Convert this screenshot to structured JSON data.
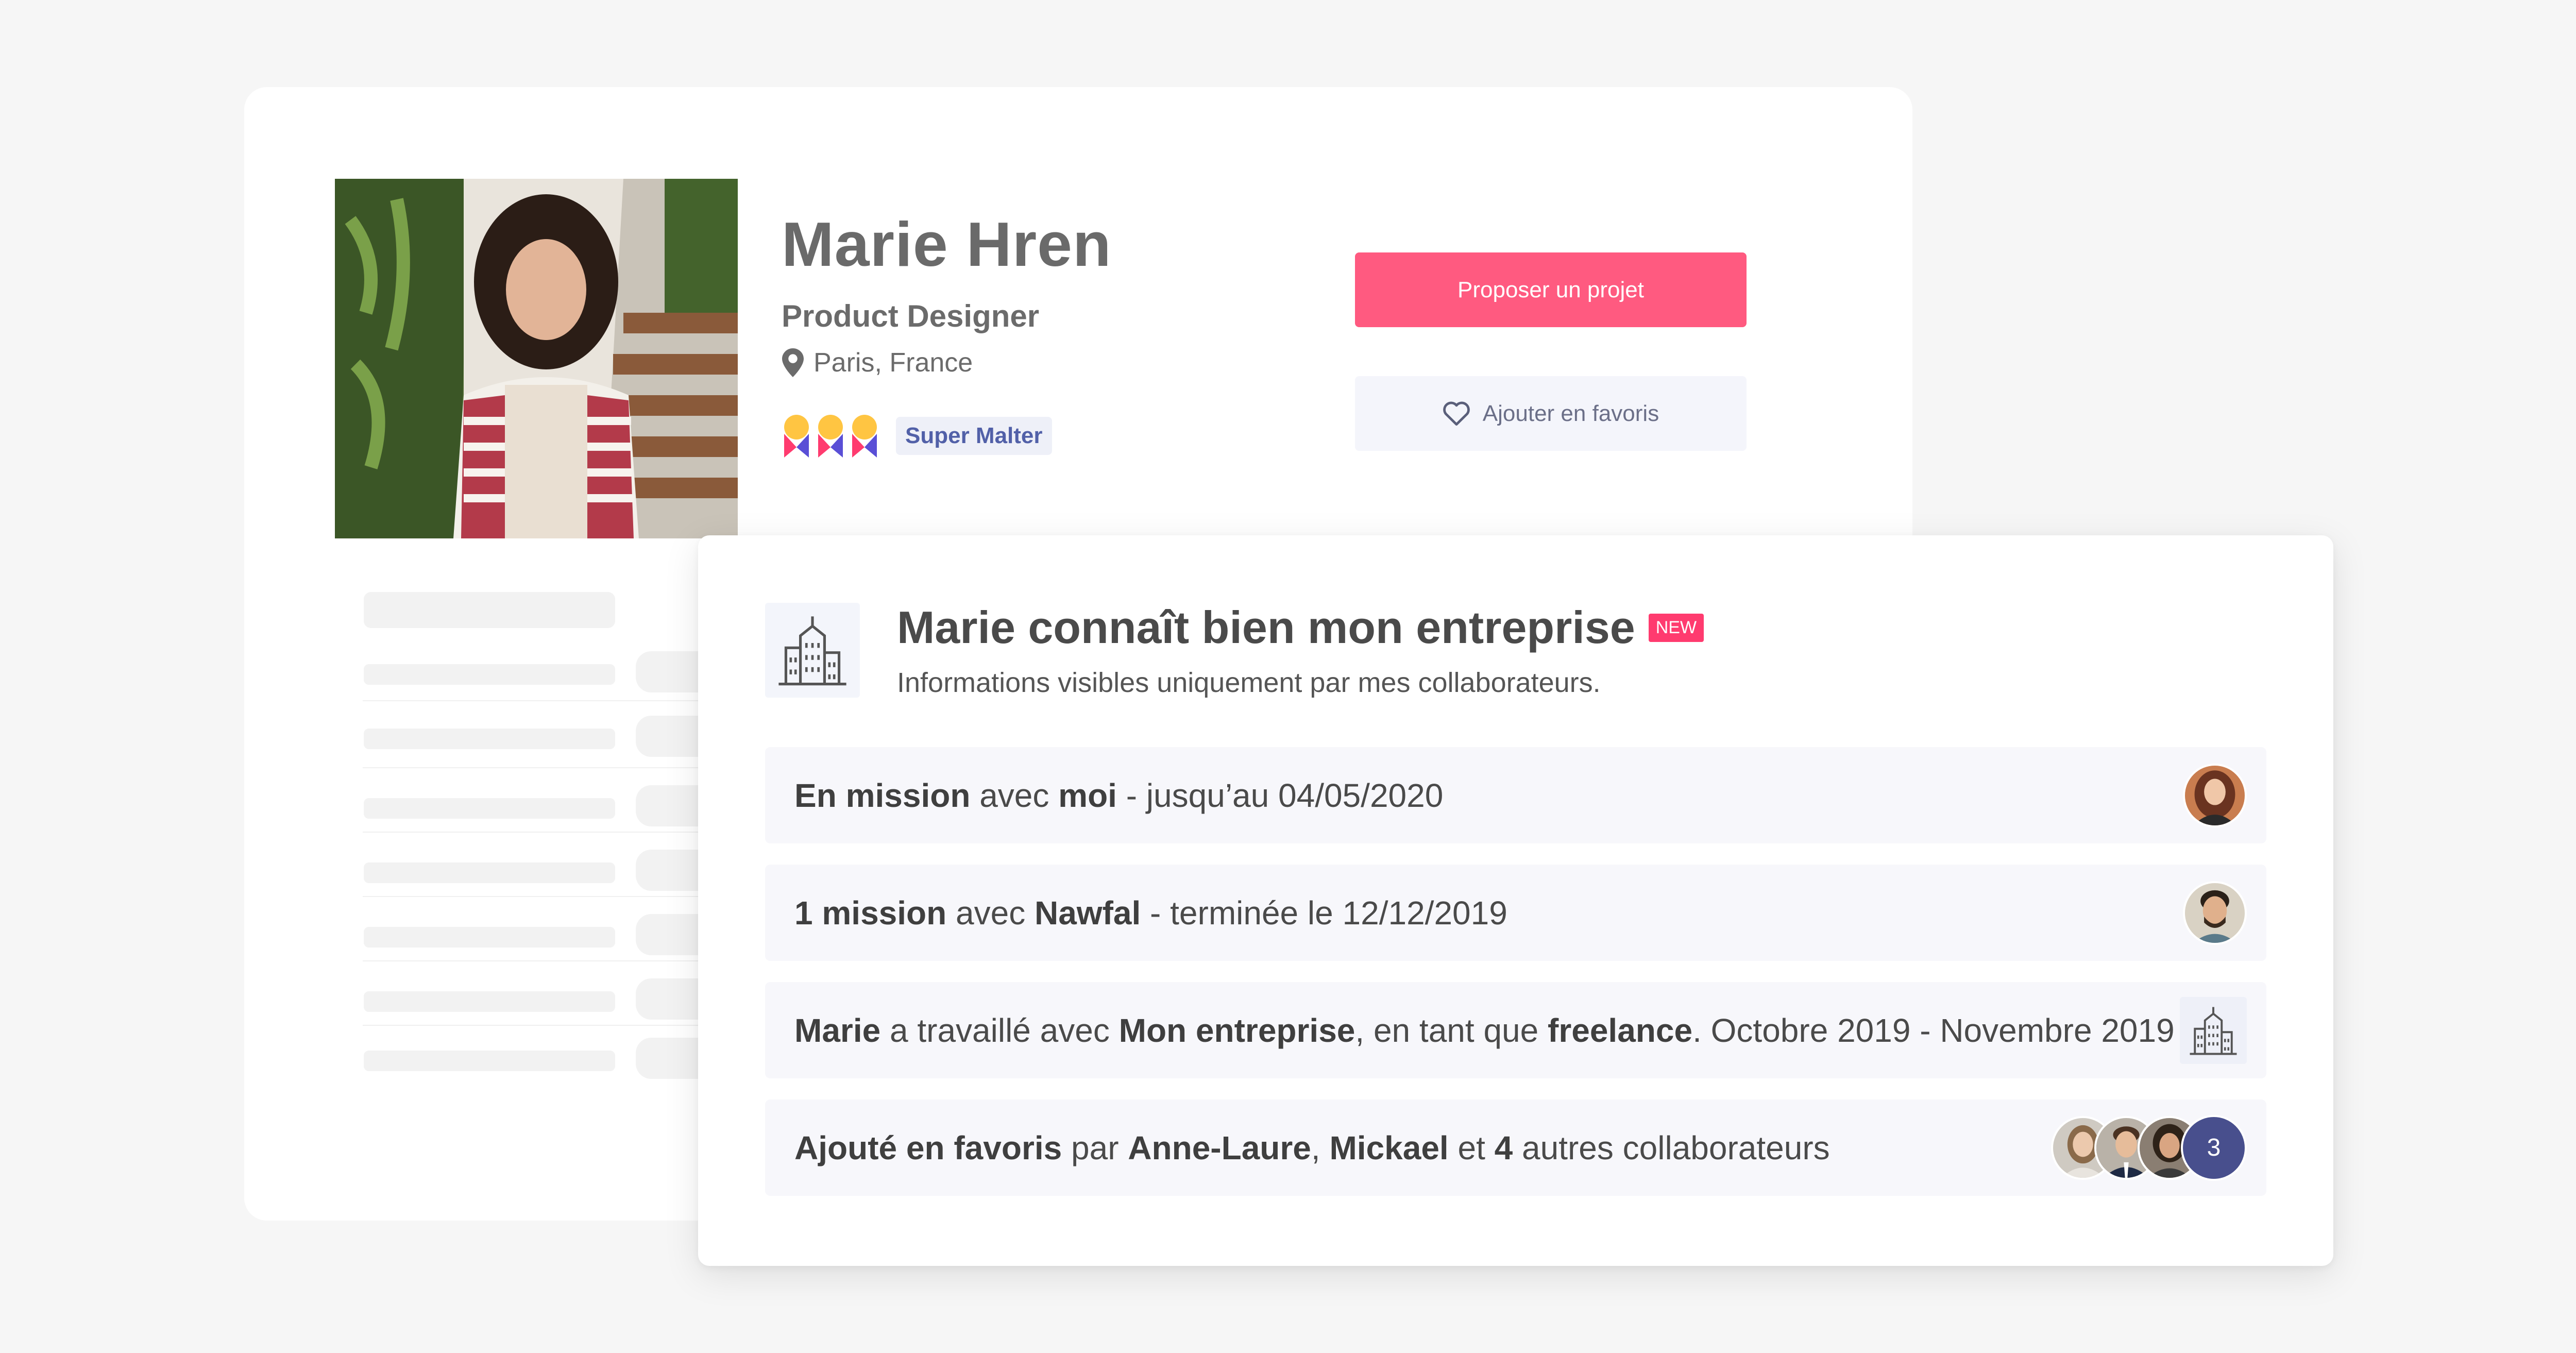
{
  "profile": {
    "name": "Marie Hren",
    "role": "Product Designer",
    "location": "Paris, France",
    "badge_label": "Super Malter",
    "propose_button": "Proposer un projet",
    "favorite_button": "Ajouter en favoris"
  },
  "panel": {
    "title": "Marie connaît bien mon entreprise",
    "new_tag": "NEW",
    "subtitle": "Informations visibles uniquement par mes collaborateurs."
  },
  "rows": [
    {
      "parts": [
        {
          "t": "En mission",
          "b": true
        },
        {
          "t": " avec ",
          "b": false
        },
        {
          "t": "moi",
          "b": true
        },
        {
          "t": " - jusqu’au 04/05/2020",
          "b": false
        }
      ]
    },
    {
      "parts": [
        {
          "t": "1 mission",
          "b": true
        },
        {
          "t": " avec ",
          "b": false
        },
        {
          "t": "Nawfal",
          "b": true
        },
        {
          "t": " - terminée le 12/12/2019",
          "b": false
        }
      ]
    },
    {
      "parts": [
        {
          "t": "Marie",
          "b": true
        },
        {
          "t": " a travaillé avec ",
          "b": false
        },
        {
          "t": "Mon entreprise",
          "b": true
        },
        {
          "t": ", en tant que ",
          "b": false
        },
        {
          "t": "freelance",
          "b": true
        },
        {
          "t": ". Octobre 2019 - Novembre 2019",
          "b": false
        }
      ]
    },
    {
      "parts": [
        {
          "t": "Ajouté en favoris",
          "b": true
        },
        {
          "t": " par ",
          "b": false
        },
        {
          "t": "Anne-Laure",
          "b": true
        },
        {
          "t": ", ",
          "b": false
        },
        {
          "t": "Mickael",
          "b": true
        },
        {
          "t": " et ",
          "b": false
        },
        {
          "t": "4",
          "b": true
        },
        {
          "t": " autres collaborateurs",
          "b": false
        }
      ],
      "extra_count": "3"
    }
  ],
  "colors": {
    "primary_button": "#ff5a80",
    "new_tag": "#ff3b6f",
    "badge_text": "#5160a8",
    "count_badge": "#484f8d"
  },
  "icons": [
    "location-pin-icon",
    "heart-icon",
    "company-building-icon",
    "malt-badge-icon"
  ]
}
